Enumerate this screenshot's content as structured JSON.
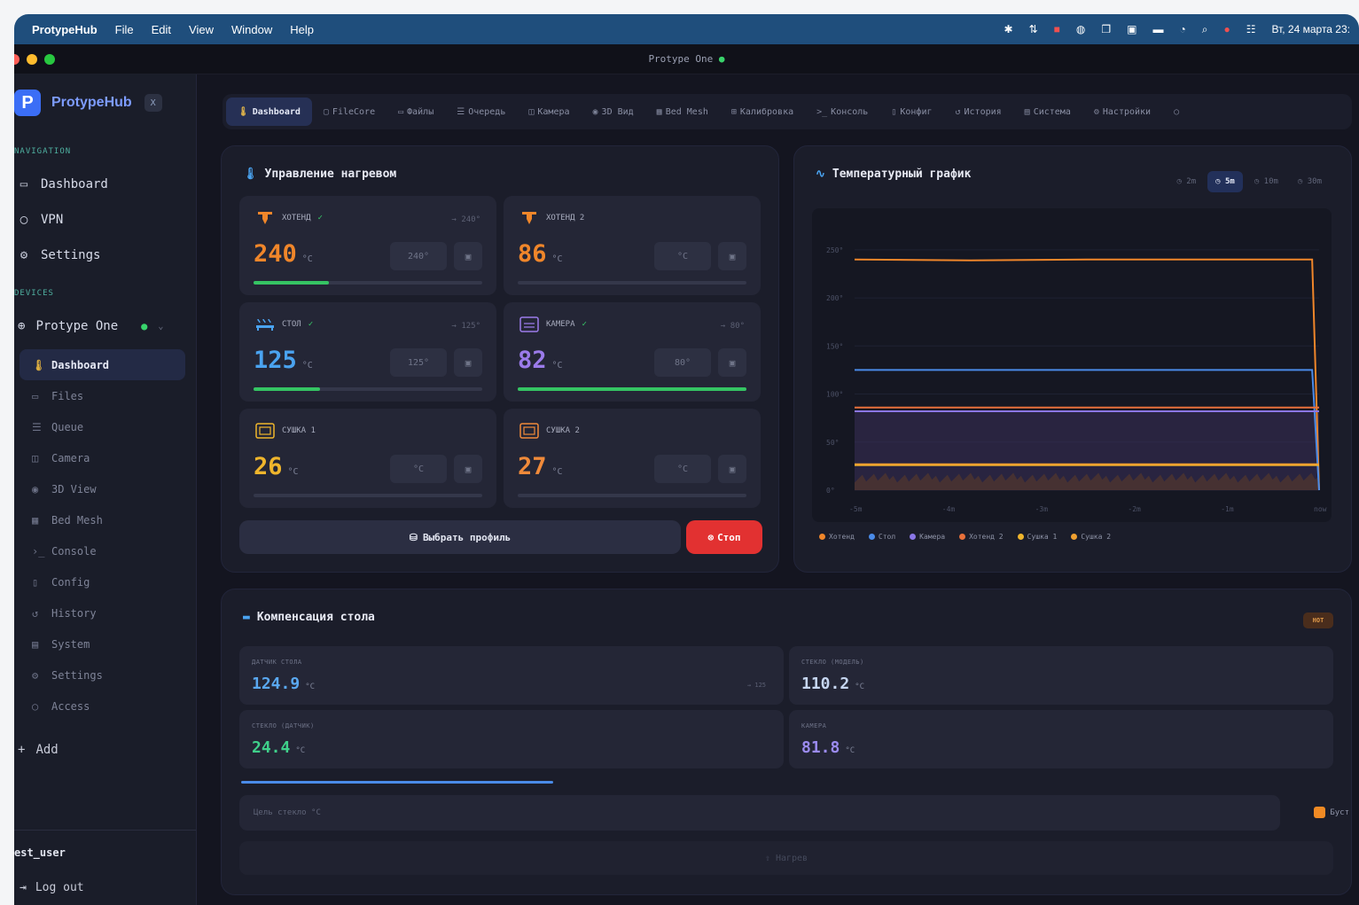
{
  "menubar": {
    "app": "ProtypeHub",
    "items": [
      "File",
      "Edit",
      "View",
      "Window",
      "Help"
    ],
    "datetime": "Вт, 24 марта 23:"
  },
  "window": {
    "title": "Protype One",
    "online_dot": "●"
  },
  "sidebar": {
    "brand": "ProtypeHub",
    "brand_badge": "X",
    "nav_label": "NAVIGATION",
    "nav": [
      {
        "label": "Dashboard",
        "icon": "monitor-icon"
      },
      {
        "label": "VPN",
        "icon": "shield-icon"
      },
      {
        "label": "Settings",
        "icon": "gear-icon"
      }
    ],
    "devices_label": "DEVICES",
    "device": {
      "name": "Protype One",
      "status": "●",
      "chevron": "⌄"
    },
    "subnav": [
      {
        "label": "Dashboard",
        "icon": "thermometer-icon",
        "active": true
      },
      {
        "label": "Files",
        "icon": "folder-icon"
      },
      {
        "label": "Queue",
        "icon": "list-icon"
      },
      {
        "label": "Camera",
        "icon": "camera-icon"
      },
      {
        "label": "3D View",
        "icon": "eye-icon"
      },
      {
        "label": "Bed Mesh",
        "icon": "grid-icon"
      },
      {
        "label": "Console",
        "icon": "terminal-icon"
      },
      {
        "label": "Config",
        "icon": "file-icon"
      },
      {
        "label": "History",
        "icon": "history-icon"
      },
      {
        "label": "System",
        "icon": "server-icon"
      },
      {
        "label": "Settings",
        "icon": "gear-icon"
      },
      {
        "label": "Access",
        "icon": "lock-icon"
      }
    ],
    "add": "Add",
    "user": "est_user",
    "logout": "Log out"
  },
  "tabs": [
    {
      "label": "Dashboard",
      "icon": "🌡",
      "active": true
    },
    {
      "label": "FileCore",
      "icon": "▢"
    },
    {
      "label": "Файлы",
      "icon": "▭"
    },
    {
      "label": "Очередь",
      "icon": "☰"
    },
    {
      "label": "Камера",
      "icon": "◫"
    },
    {
      "label": "3D Вид",
      "icon": "◉"
    },
    {
      "label": "Bed Mesh",
      "icon": "▦"
    },
    {
      "label": "Калибровка",
      "icon": "⊞"
    },
    {
      "label": "Консоль",
      "icon": ">_"
    },
    {
      "label": "Конфиг",
      "icon": "▯"
    },
    {
      "label": "История",
      "icon": "↺"
    },
    {
      "label": "Система",
      "icon": "▤"
    },
    {
      "label": "Настройки",
      "icon": "⚙"
    },
    {
      "label": "",
      "icon": "○"
    }
  ],
  "heating": {
    "title": "Управление нагревом",
    "cards": [
      {
        "name": "ХОТЕНД",
        "value": "240",
        "unit": "°C",
        "target": "→ 240°",
        "input": "240°",
        "progress": 0.33,
        "color": "#f0862a",
        "check": true,
        "icon": "hotend-icon"
      },
      {
        "name": "ХОТЕНД 2",
        "value": "86",
        "unit": "°C",
        "target": "",
        "input": "°C",
        "progress": 0,
        "color": "#f0862a",
        "check": false,
        "icon": "hotend-icon"
      },
      {
        "name": "СТОЛ",
        "value": "125",
        "unit": "°C",
        "target": "→ 125°",
        "input": "125°",
        "progress": 0.29,
        "color": "#4aa3f0",
        "check": true,
        "icon": "bed-icon"
      },
      {
        "name": "КАМЕРА",
        "value": "82",
        "unit": "°C",
        "target": "→ 80°",
        "input": "80°",
        "progress": 1.0,
        "color": "#9b7bea",
        "check": true,
        "icon": "chamber-icon"
      },
      {
        "name": "СУШКА 1",
        "value": "26",
        "unit": "°C",
        "target": "",
        "input": "°C",
        "progress": 0,
        "color": "#efb52c",
        "check": false,
        "icon": "dryer-icon"
      },
      {
        "name": "СУШКА 2",
        "value": "27",
        "unit": "°C",
        "target": "",
        "input": "°C",
        "progress": 0,
        "color": "#f08a3a",
        "check": false,
        "icon": "dryer-icon"
      }
    ],
    "profile_button": "Выбрать профиль",
    "stop_button": "Стоп"
  },
  "chart_panel": {
    "title": "Температурный график",
    "ranges": [
      {
        "label": "◷ 2m",
        "active": false
      },
      {
        "label": "◷ 5m",
        "active": true
      },
      {
        "label": "◷ 10m",
        "active": false
      },
      {
        "label": "◷ 30m",
        "active": false
      }
    ]
  },
  "chart_data": {
    "type": "line",
    "ylim": [
      0,
      260
    ],
    "yticks": [
      "250°",
      "200°",
      "150°",
      "100°",
      "50°",
      "0°"
    ],
    "xticks": [
      "-5m",
      "-4m",
      "-3m",
      "-2m",
      "-1m",
      "now"
    ],
    "x": [
      0,
      0.25,
      0.5,
      0.75,
      0.985,
      1.0
    ],
    "series": [
      {
        "name": "Хотенд",
        "color": "#f0862a",
        "values": [
          240,
          239,
          240,
          240,
          240,
          0
        ]
      },
      {
        "name": "Стол",
        "color": "#4a8be8",
        "values": [
          125,
          125,
          125,
          125,
          125,
          0
        ]
      },
      {
        "name": "Камера",
        "color": "#8a76e6",
        "values": [
          82,
          82,
          82,
          82,
          82,
          82
        ]
      },
      {
        "name": "Хотенд 2",
        "color": "#e8703a",
        "values": [
          86,
          86,
          86,
          86,
          86,
          86
        ]
      },
      {
        "name": "Сушка 1",
        "color": "#efb52c",
        "values": [
          26,
          26,
          26,
          26,
          26,
          26
        ]
      },
      {
        "name": "Сушка 2",
        "color": "#f0a030",
        "values": [
          27,
          27,
          27,
          27,
          27,
          27
        ]
      }
    ]
  },
  "compensation": {
    "title": "Компенсация стола",
    "badge": "HOT",
    "cards": [
      {
        "label": "ДАТЧИК СТОЛА",
        "value": "124.9",
        "unit": "°C",
        "right": "→ 125",
        "color": "#5aa8f0"
      },
      {
        "label": "СТЕКЛО (МОДЕЛЬ)",
        "value": "110.2",
        "unit": "°C",
        "right": "",
        "color": "#c6d6f0"
      },
      {
        "label": "СТЕКЛО (ДАТЧИК)",
        "value": "24.4",
        "unit": "°C",
        "right": "",
        "color": "#3fcf8a"
      },
      {
        "label": "КАМЕРА",
        "value": "81.8",
        "unit": "°C",
        "right": "",
        "color": "#9b8bef"
      }
    ],
    "glass_placeholder": "Цель стекло °C",
    "auto_label": "Буст",
    "apply_button": "⇧ Нагрев"
  }
}
